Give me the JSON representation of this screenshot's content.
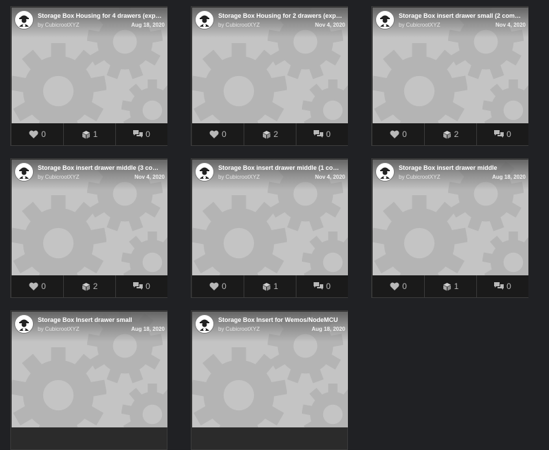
{
  "cards": [
    {
      "title": "Storage Box Housing for 4 drawers (exp…",
      "author": "by CubicrootXYZ",
      "date": "Aug 18, 2020",
      "likes": "0",
      "makes": "1",
      "comments": "0"
    },
    {
      "title": "Storage Box Housing for 2 drawers (exp…",
      "author": "by CubicrootXYZ",
      "date": "Nov 4, 2020",
      "likes": "0",
      "makes": "2",
      "comments": "0"
    },
    {
      "title": "Storage Box insert drawer small (2 com…",
      "author": "by CubicrootXYZ",
      "date": "Nov 4, 2020",
      "likes": "0",
      "makes": "2",
      "comments": "0"
    },
    {
      "title": "Storage Box insert drawer middle (3 co…",
      "author": "by CubicrootXYZ",
      "date": "Nov 4, 2020",
      "likes": "0",
      "makes": "2",
      "comments": "0"
    },
    {
      "title": "Storage Box insert drawer middle (1 co…",
      "author": "by CubicrootXYZ",
      "date": "Nov 4, 2020",
      "likes": "0",
      "makes": "1",
      "comments": "0"
    },
    {
      "title": "Storage Box insert drawer middle",
      "author": "by CubicrootXYZ",
      "date": "Aug 18, 2020",
      "likes": "0",
      "makes": "1",
      "comments": "0"
    },
    {
      "title": "Storage Box Insert drawer small",
      "author": "by CubicrootXYZ",
      "date": "Aug 18, 2020",
      "likes": "",
      "makes": "",
      "comments": ""
    },
    {
      "title": "Storage Box Insert for Wemos/NodeMCU",
      "author": "by CubicrootXYZ",
      "date": "Aug 18, 2020",
      "likes": "",
      "makes": "",
      "comments": ""
    }
  ],
  "icons": {
    "like": "heart-icon",
    "make": "cube-icon",
    "comment": "comment-icon",
    "avatar": "avatar-icon",
    "placeholder": "gears-placeholder"
  },
  "colors": {
    "background": "#202124",
    "thumbnail": "#c4c4c4",
    "gear": "#b4b4b4",
    "stats_bar": "#1a1a1a"
  }
}
